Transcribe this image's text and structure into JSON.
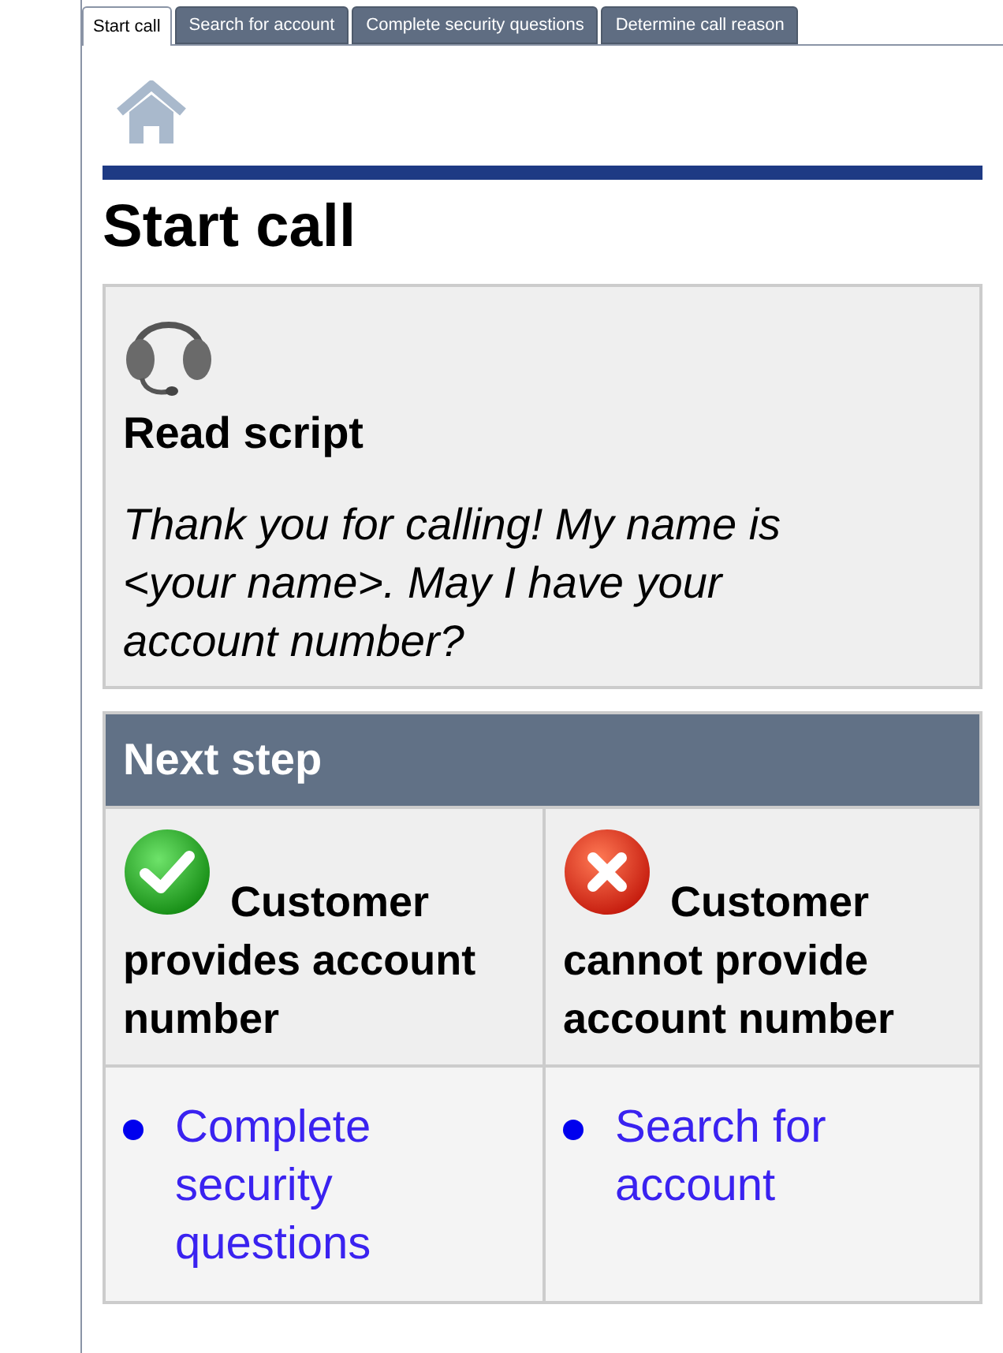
{
  "tabs": [
    {
      "label": "Start call",
      "selected": true
    },
    {
      "label": "Search for account",
      "selected": false
    },
    {
      "label": "Complete security questions",
      "selected": false
    },
    {
      "label": "Determine call reason",
      "selected": false
    }
  ],
  "page_title": "Start call",
  "script_card": {
    "heading": "Read script",
    "text": "Thank you for calling! My name is <your name>. May I have your account number?"
  },
  "next_step": {
    "heading": "Next step",
    "options": [
      {
        "kind": "yes",
        "label": "Customer provides account number",
        "links": [
          "Complete security questions"
        ]
      },
      {
        "kind": "no",
        "label": "Customer cannot provide account number",
        "links": [
          "Search for account"
        ]
      }
    ]
  }
}
